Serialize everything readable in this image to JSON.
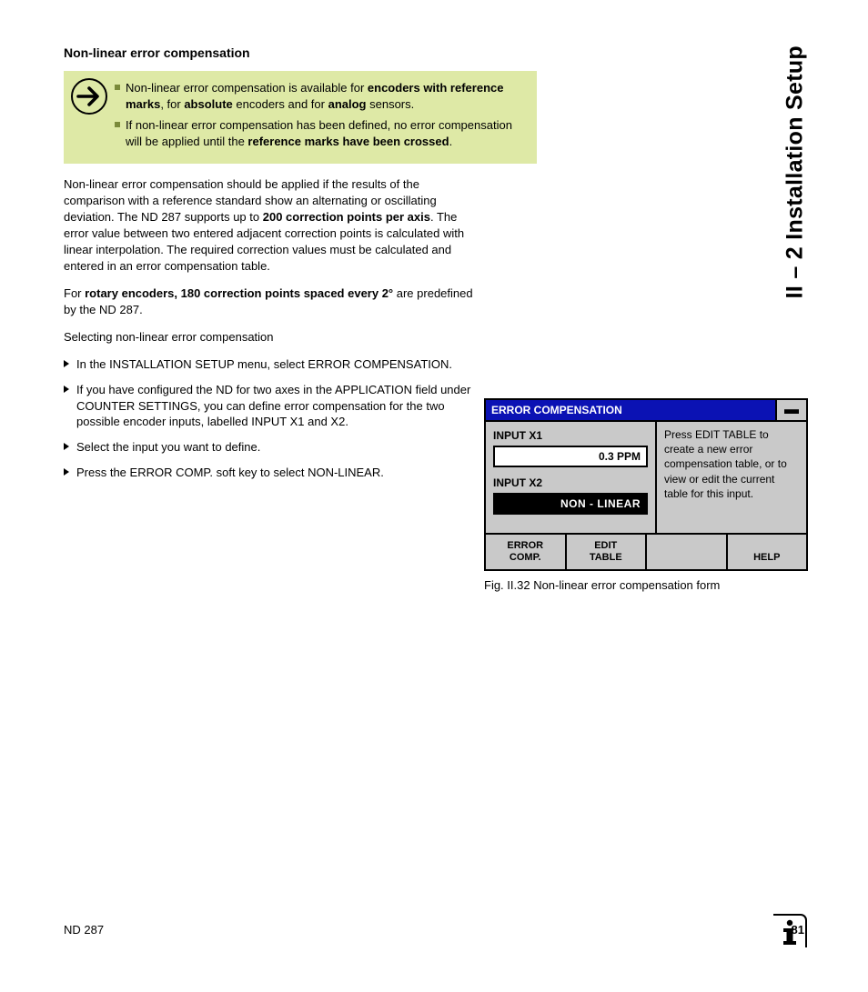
{
  "sideTitle": "II – 2 Installation Setup",
  "heading": "Non-linear error compensation",
  "callout": {
    "b1a": "Non-linear error compensation is available for ",
    "b1b": "encoders with reference marks",
    "b1c": ", for ",
    "b1d": "absolute",
    "b1e": " encoders and for ",
    "b1f": "analog",
    "b1g": " sensors.",
    "b2a": "If non-linear error compensation has been defined, no error compensation will be applied until the ",
    "b2b": "reference marks have been crossed",
    "b2c": "."
  },
  "para1a": "Non-linear error compensation should be applied if the results of the comparison with a reference standard show an alternating or oscillating deviation. The ND 287 supports up to ",
  "para1b": "200 correction points per axis",
  "para1c": ". The error value between two entered adjacent correction points is calculated with linear interpolation. The required correction values must be calculated and entered in an error compensation table.",
  "para2a": "For ",
  "para2b": "rotary encoders, 180 correction points spaced every 2°",
  "para2c": " are predefined by the ND 287.",
  "para3": "Selecting non-linear error compensation",
  "steps": [
    "In the INSTALLATION SETUP menu, select ERROR COMPENSATION.",
    "If you have configured the ND for two axes in the APPLICATION field under COUNTER SETTINGS, you can define error compensation for the two possible encoder inputs, labelled INPUT X1 and X2.",
    "Select the input you want to define.",
    "Press the ERROR COMP. soft key to select NON-LINEAR."
  ],
  "figure": {
    "title": "ERROR COMPENSATION",
    "inputX1": "INPUT X1",
    "inputX1val": "0.3 PPM",
    "inputX2": "INPUT X2",
    "inputX2val": "NON - LINEAR",
    "hint": "Press EDIT TABLE to create a new error compensation table, or to view or edit the current table for this input.",
    "sk1a": "ERROR",
    "sk1b": "COMP.",
    "sk2a": "EDIT",
    "sk2b": "TABLE",
    "sk3": "",
    "sk4": "HELP",
    "caption": "Fig. II.32   Non-linear error compensation form"
  },
  "footer": {
    "left": "ND 287",
    "page": "81"
  }
}
